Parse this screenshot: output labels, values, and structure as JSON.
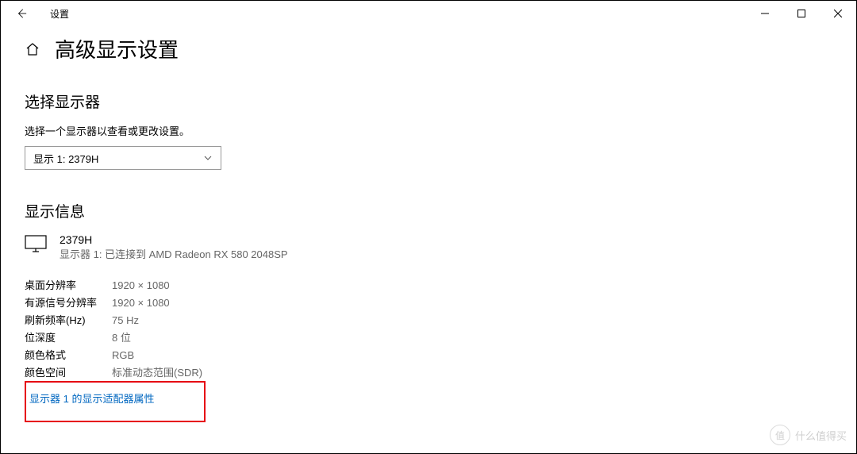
{
  "window": {
    "title": "设置"
  },
  "page": {
    "title": "高级显示设置"
  },
  "select_display": {
    "heading": "选择显示器",
    "description": "选择一个显示器以查看或更改设置。",
    "dropdown_value": "显示 1: 2379H"
  },
  "display_info": {
    "heading": "显示信息",
    "name": "2379H",
    "sub": "显示器 1: 已连接到 AMD Radeon RX 580 2048SP",
    "specs": [
      {
        "label": "桌面分辨率",
        "value": "1920 × 1080"
      },
      {
        "label": "有源信号分辨率",
        "value": "1920 × 1080"
      },
      {
        "label": "刷新频率(Hz)",
        "value": "75 Hz"
      },
      {
        "label": "位深度",
        "value": "8 位"
      },
      {
        "label": "颜色格式",
        "value": "RGB"
      },
      {
        "label": "颜色空间",
        "value": "标准动态范围(SDR)"
      }
    ],
    "adapter_link": "显示器 1 的显示适配器属性"
  },
  "watermark": {
    "logo_char": "值",
    "text": "什么值得买"
  }
}
